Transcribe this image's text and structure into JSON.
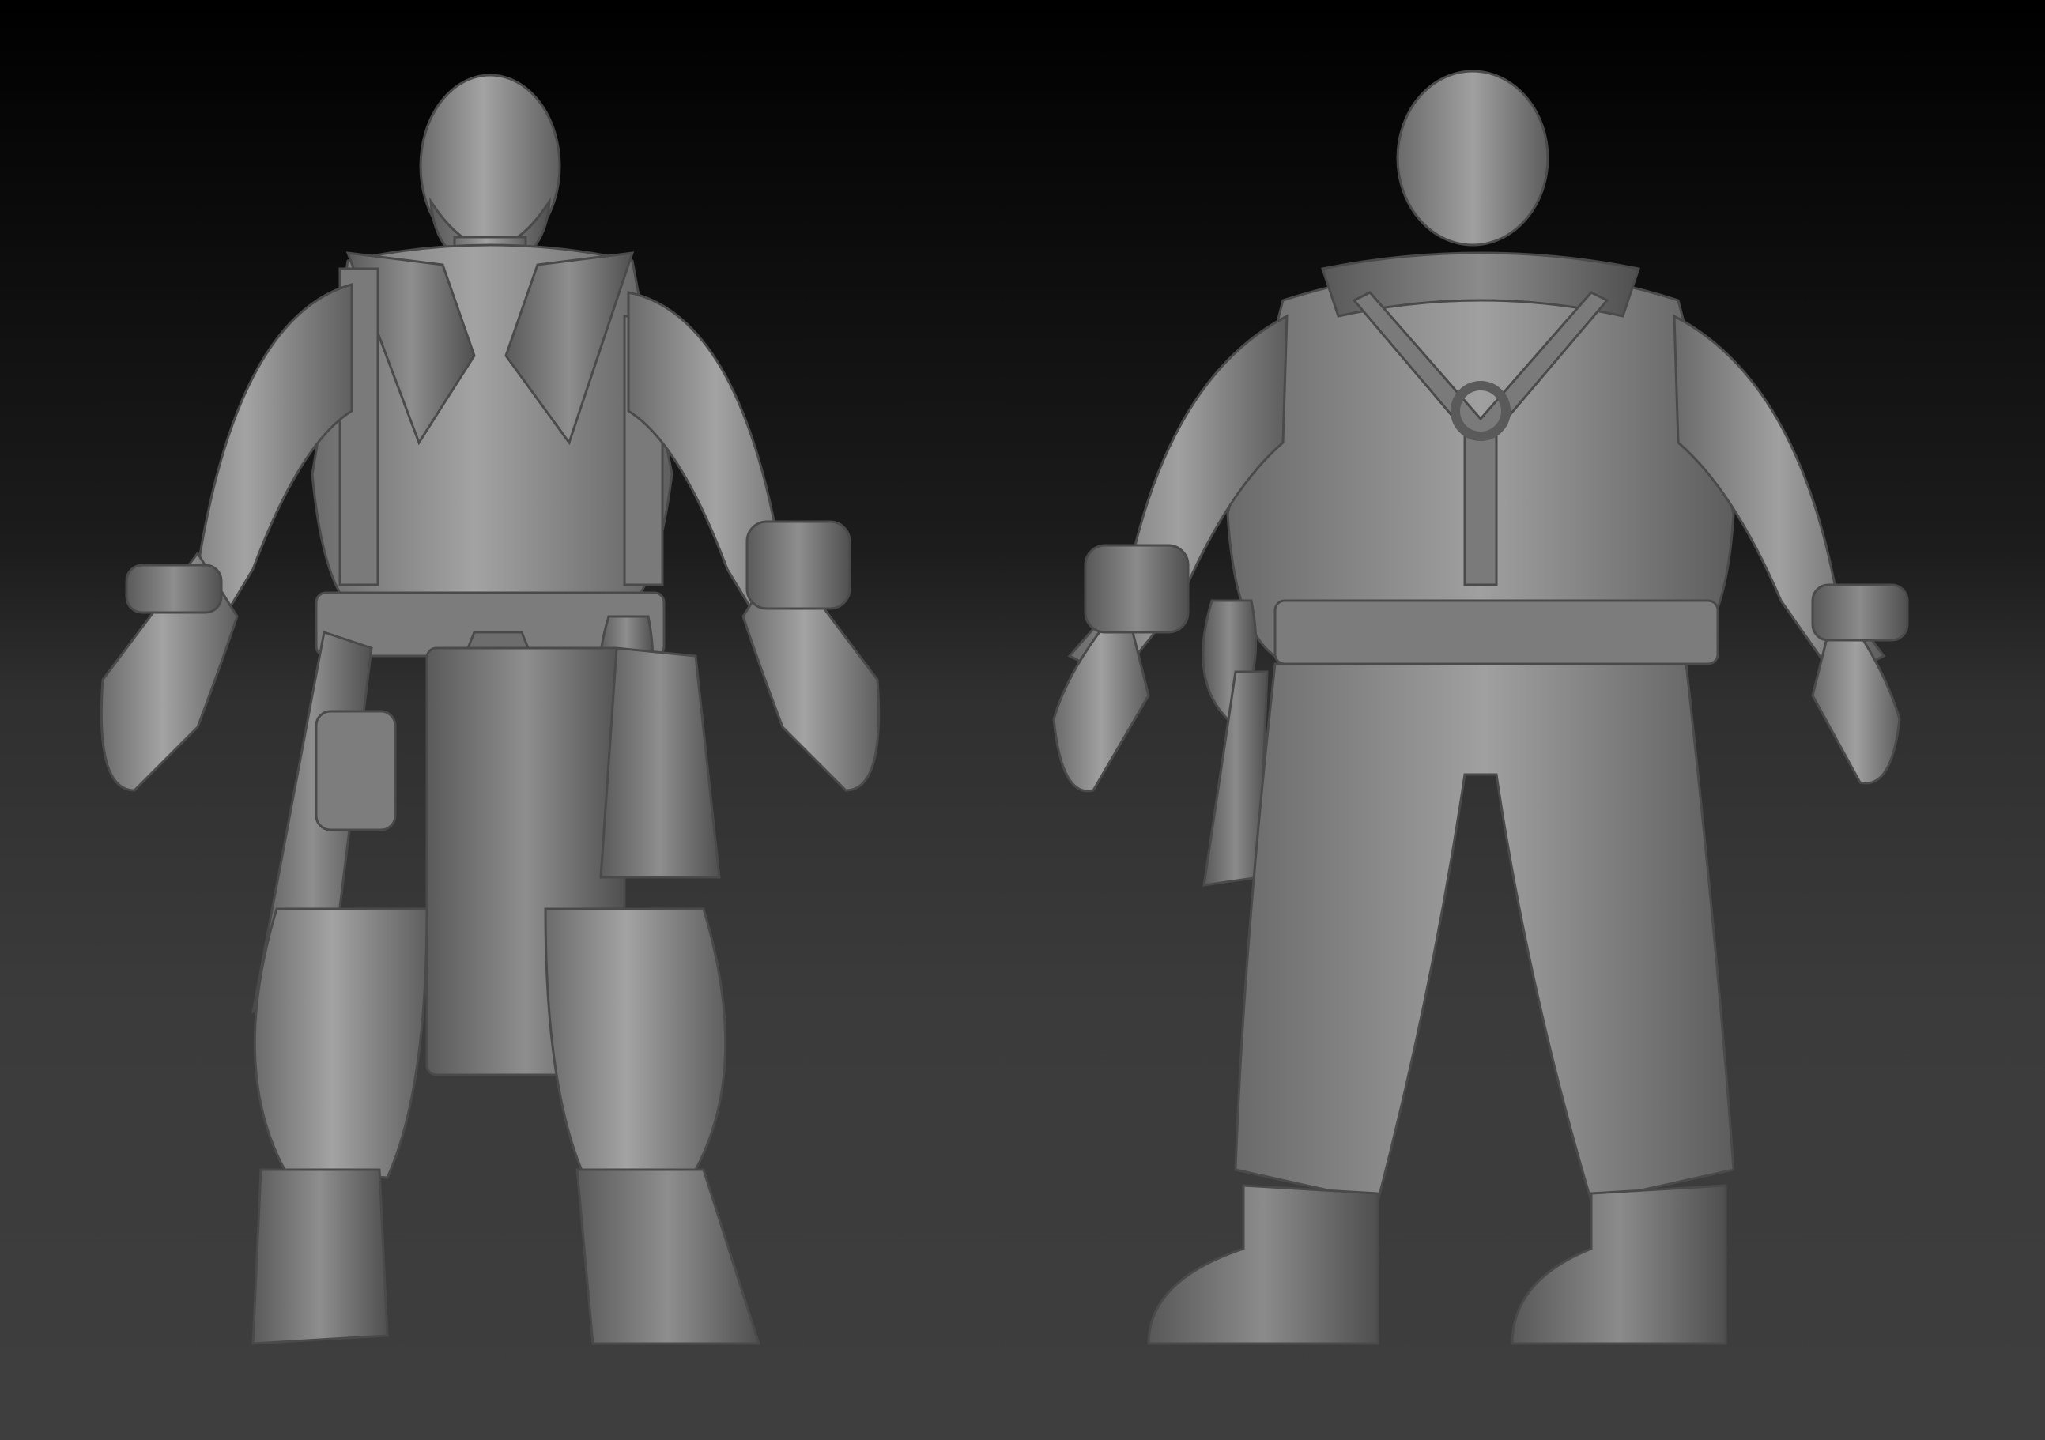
{
  "scene": {
    "background_top": "#000000",
    "background_bottom": "#3e3e3e",
    "clay_base": "#8c8c8c",
    "clay_light": "#a6a6a6",
    "clay_shadow": "#555555"
  },
  "figures": [
    {
      "view": "front"
    },
    {
      "view": "back"
    }
  ]
}
